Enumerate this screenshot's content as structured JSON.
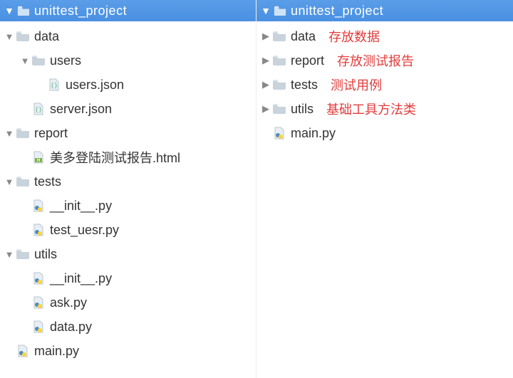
{
  "left": {
    "title": "unittest_project",
    "items": [
      {
        "depth": 0,
        "arrow": "down",
        "icon": "folder",
        "label": "data"
      },
      {
        "depth": 1,
        "arrow": "down",
        "icon": "folder",
        "label": "users"
      },
      {
        "depth": 2,
        "arrow": "",
        "icon": "json",
        "label": "users.json"
      },
      {
        "depth": 1,
        "arrow": "",
        "icon": "json",
        "label": "server.json"
      },
      {
        "depth": 0,
        "arrow": "down",
        "icon": "folder",
        "label": "report"
      },
      {
        "depth": 1,
        "arrow": "",
        "icon": "html",
        "label": "美多登陆测试报告.html"
      },
      {
        "depth": 0,
        "arrow": "down",
        "icon": "folder",
        "label": "tests"
      },
      {
        "depth": 1,
        "arrow": "",
        "icon": "python",
        "label": "__init__.py"
      },
      {
        "depth": 1,
        "arrow": "",
        "icon": "python",
        "label": "test_uesr.py"
      },
      {
        "depth": 0,
        "arrow": "down",
        "icon": "folder",
        "label": "utils"
      },
      {
        "depth": 1,
        "arrow": "",
        "icon": "python",
        "label": "__init__.py"
      },
      {
        "depth": 1,
        "arrow": "",
        "icon": "python",
        "label": "ask.py"
      },
      {
        "depth": 1,
        "arrow": "",
        "icon": "python",
        "label": "data.py"
      },
      {
        "depth": 0,
        "arrow": "",
        "icon": "python",
        "label": "main.py"
      }
    ]
  },
  "right": {
    "title": "unittest_project",
    "items": [
      {
        "depth": 0,
        "arrow": "right",
        "icon": "folder",
        "label": "data",
        "note": "存放数据"
      },
      {
        "depth": 0,
        "arrow": "right",
        "icon": "folder",
        "label": "report",
        "note": "存放测试报告"
      },
      {
        "depth": 0,
        "arrow": "right",
        "icon": "folder",
        "label": "tests",
        "note": "测试用例"
      },
      {
        "depth": 0,
        "arrow": "right",
        "icon": "folder",
        "label": "utils",
        "note": "基础工具方法类"
      },
      {
        "depth": 0,
        "arrow": "",
        "icon": "python",
        "label": "main.py"
      }
    ]
  },
  "arrows": {
    "down": "▼",
    "right": "▶"
  }
}
